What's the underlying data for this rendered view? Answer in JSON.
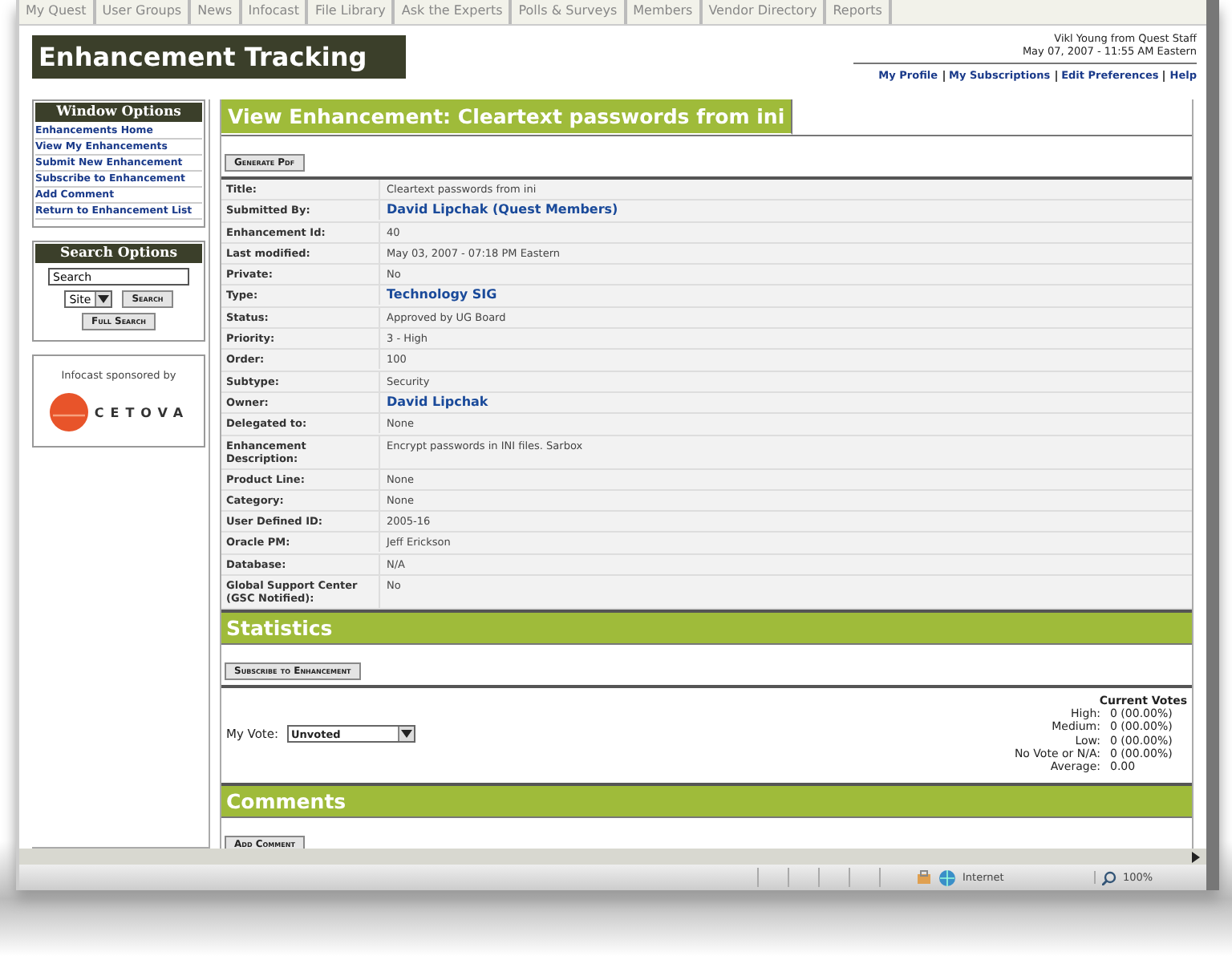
{
  "nav_tabs": [
    "My Quest",
    "User Groups",
    "News",
    "Infocast",
    "File Library",
    "Ask the Experts",
    "Polls & Surveys",
    "Members",
    "Vendor Directory",
    "Reports"
  ],
  "header": {
    "title": "Enhancement Tracking",
    "user": "Vikl Young from Quest Staff",
    "date": "May 07, 2007 - 11:55 AM Eastern",
    "links": [
      "My Profile",
      "My Subscriptions",
      "Edit Preferences",
      "Help"
    ]
  },
  "window_options": {
    "title": "Window Options",
    "items": [
      "Enhancements Home",
      "View My Enhancements",
      "Submit New Enhancement",
      "Subscribe to Enhancement",
      "Add Comment",
      "Return to Enhancement List"
    ]
  },
  "search_options": {
    "title": "Search Options",
    "value": "Search",
    "scope": "Site",
    "search_button": "Search",
    "full_search_button": "Full Search"
  },
  "sponsor": {
    "label": "Infocast sponsored by",
    "logo_text": "CETOVA"
  },
  "page_title": "View Enhancement: Cleartext passwords from ini",
  "generate_button": "Generate Pdf",
  "fields": [
    {
      "label": "Title:",
      "value": "Cleartext passwords from ini",
      "link": false
    },
    {
      "label": "Submitted By:",
      "value": "David Lipchak  (Quest Members)",
      "link": true
    },
    {
      "label": "Enhancement Id:",
      "value": "40",
      "link": false
    },
    {
      "label": "Last modified:",
      "value": "May 03, 2007 - 07:18 PM Eastern",
      "link": false
    },
    {
      "label": "Private:",
      "value": "No",
      "link": false
    },
    {
      "label": "Type:",
      "value": "Technology SIG",
      "link": true
    },
    {
      "label": "Status:",
      "value": "Approved by UG Board",
      "link": false
    },
    {
      "label": "Priority:",
      "value": "3 - High",
      "link": false
    },
    {
      "label": "Order:",
      "value": "100",
      "link": false
    },
    {
      "label": "Subtype:",
      "value": "Security",
      "link": false
    },
    {
      "label": "Owner:",
      "value": "David Lipchak",
      "link": true
    },
    {
      "label": "Delegated to:",
      "value": "None",
      "link": false
    },
    {
      "label": "Enhancement Description:",
      "value": "Encrypt passwords in INI files. Sarbox",
      "link": false
    },
    {
      "label": "Product Line:",
      "value": "None",
      "link": false
    },
    {
      "label": "Category:",
      "value": "None",
      "link": false
    },
    {
      "label": "User Defined ID:",
      "value": "2005-16",
      "link": false
    },
    {
      "label": "Oracle PM:",
      "value": "Jeff Erickson",
      "link": false
    },
    {
      "label": "Database:",
      "value": "N/A",
      "link": false
    },
    {
      "label": "Global Support Center (GSC Notified):",
      "value": "No",
      "link": false
    }
  ],
  "statistics": {
    "title": "Statistics",
    "subscribe_button": "Subscribe to Enhancement",
    "my_vote_label": "My Vote:",
    "my_vote": "Unvoted",
    "votes_title": "Current Votes",
    "votes": [
      {
        "label": "High:",
        "value": "0 (00.00%)"
      },
      {
        "label": "Medium:",
        "value": "0 (00.00%)"
      },
      {
        "label": "Low:",
        "value": "0 (00.00%)"
      },
      {
        "label": "No Vote or N/A:",
        "value": "0 (00.00%)"
      },
      {
        "label": "Average:",
        "value": "0.00"
      }
    ]
  },
  "comments": {
    "title": "Comments",
    "add_button": "Add Comment"
  },
  "status_bar": {
    "zone": "Internet",
    "zoom": "100%"
  }
}
